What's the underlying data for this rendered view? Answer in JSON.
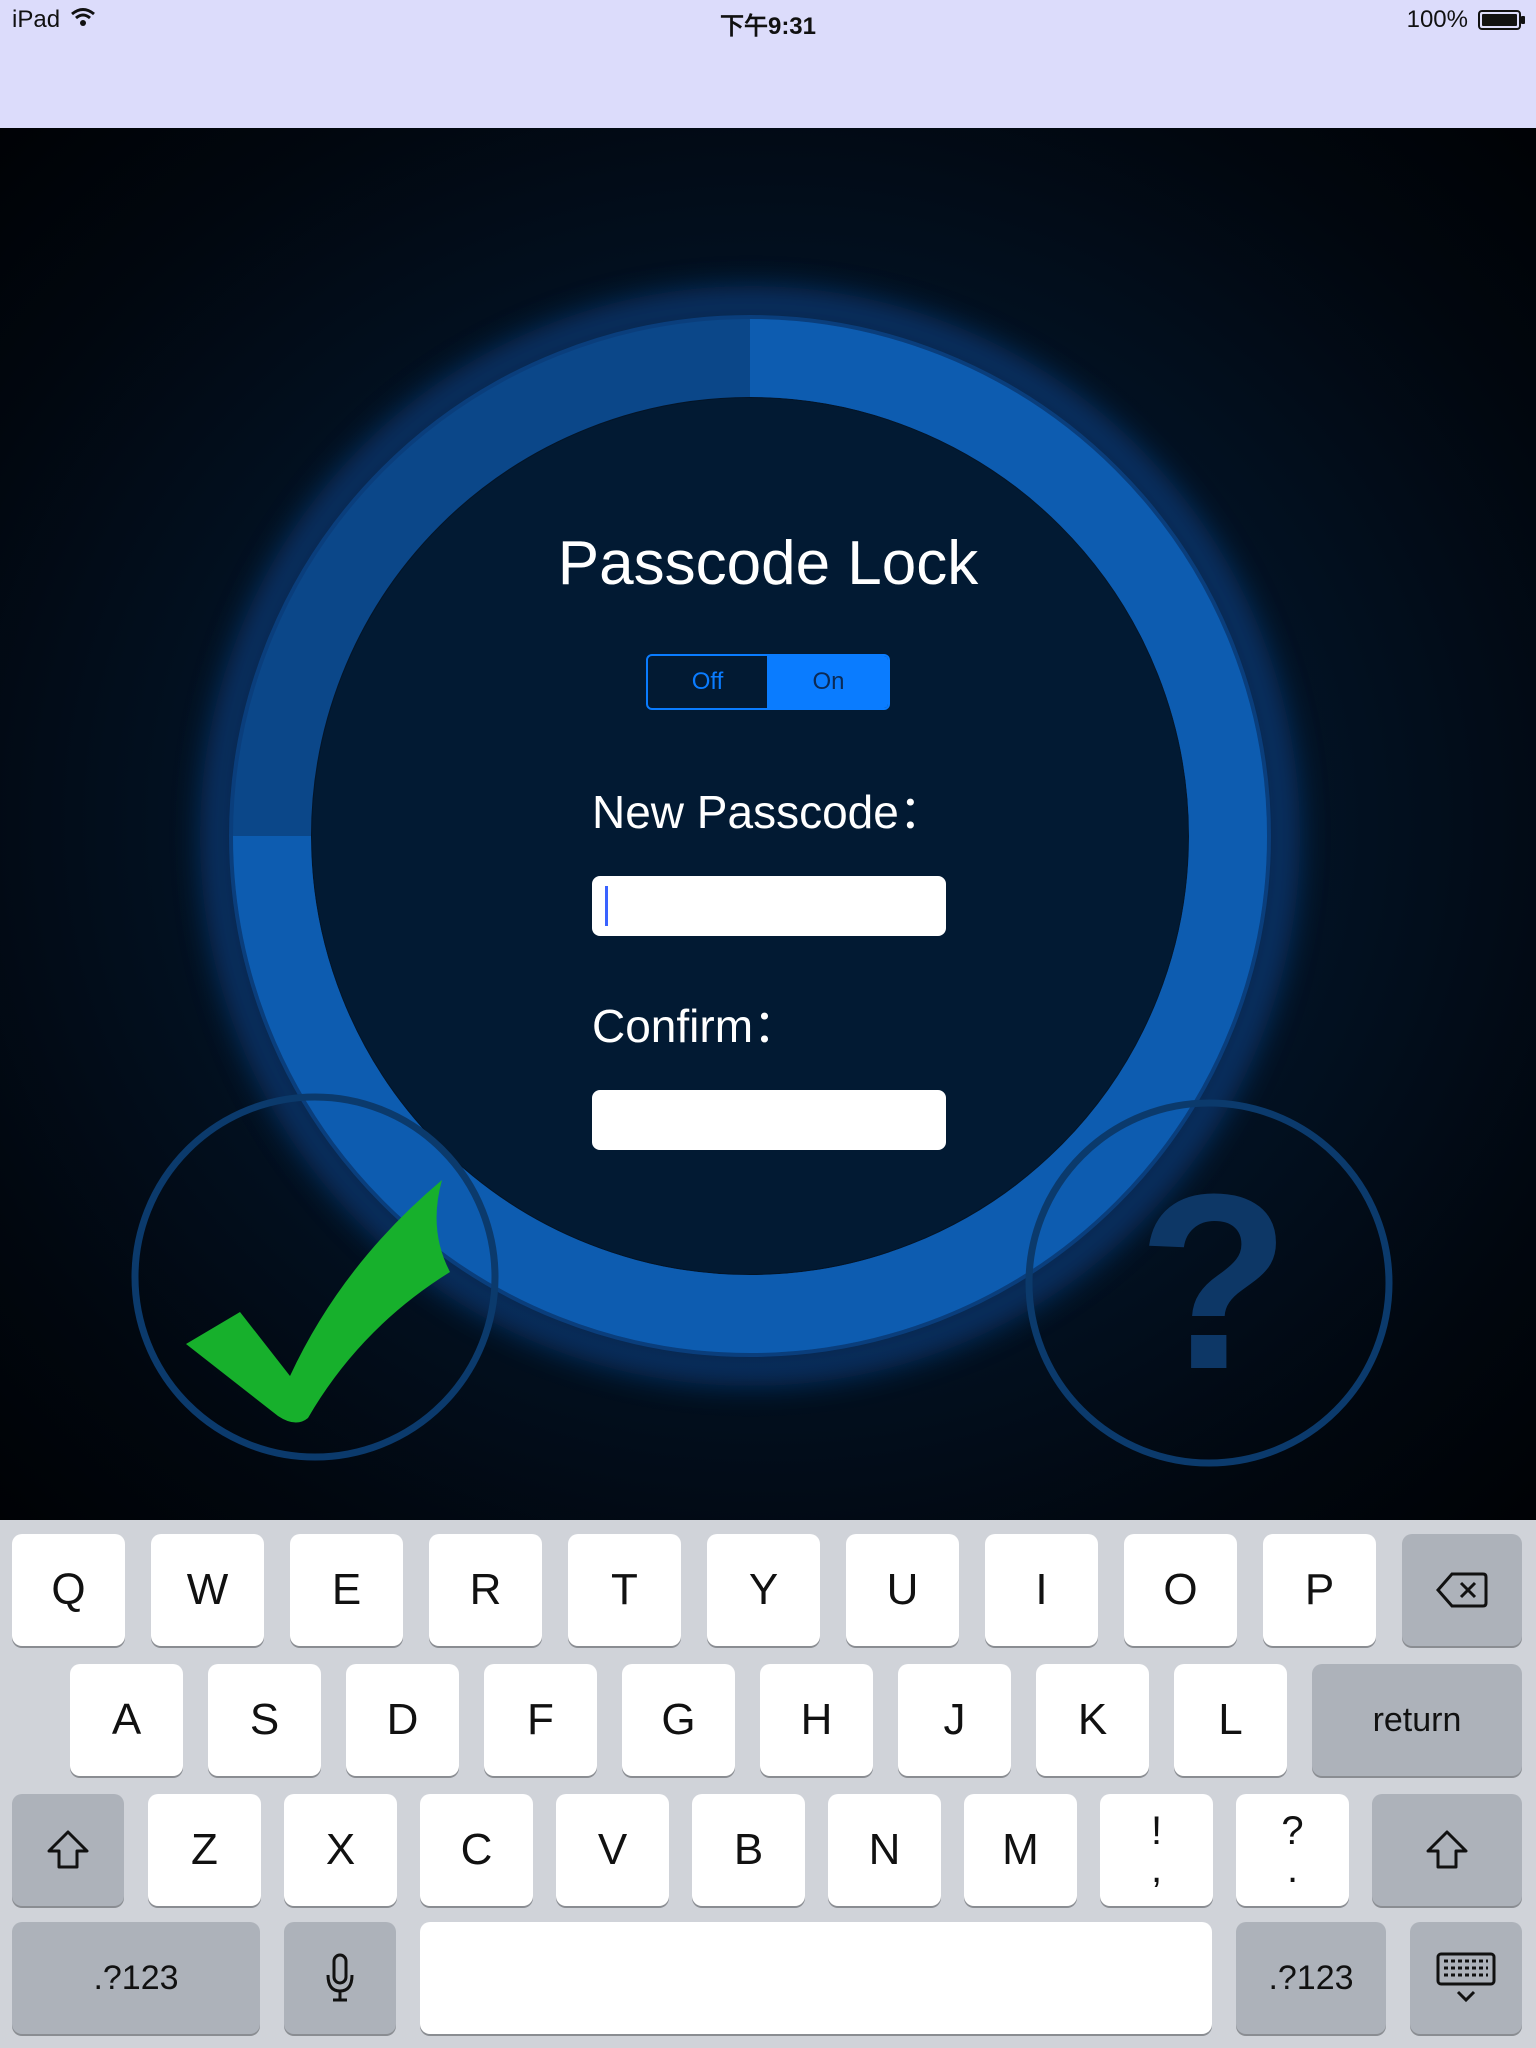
{
  "status_bar": {
    "carrier": "iPad",
    "time": "下午9:31",
    "battery": "100%"
  },
  "lock": {
    "title": "Passcode Lock",
    "toggle": {
      "off_label": "Off",
      "on_label": "On",
      "selected": "On"
    },
    "new_passcode_label": "New Passcode：",
    "new_passcode_value": "",
    "confirm_label": "Confirm：",
    "confirm_value": "",
    "help_symbol": "?"
  },
  "colors": {
    "status_bar_bg": "#dcdcfb",
    "accent": "#0a7cff",
    "ring": "#0d5cb0",
    "check": "#17b02c"
  },
  "keyboard": {
    "row1": [
      "Q",
      "W",
      "E",
      "R",
      "T",
      "Y",
      "U",
      "I",
      "O",
      "P"
    ],
    "row2": [
      "A",
      "S",
      "D",
      "F",
      "G",
      "H",
      "J",
      "K",
      "L"
    ],
    "row3": [
      "Z",
      "X",
      "C",
      "V",
      "B",
      "N",
      "M"
    ],
    "punct1_top": "!",
    "punct1_bottom": ",",
    "punct2_top": "?",
    "punct2_bottom": ".",
    "return_label": "return",
    "numbers_label": ".?123",
    "icons": {
      "delete": "backspace-icon",
      "shift": "shift-icon",
      "mic": "microphone-icon",
      "hide": "hide-keyboard-icon"
    }
  }
}
